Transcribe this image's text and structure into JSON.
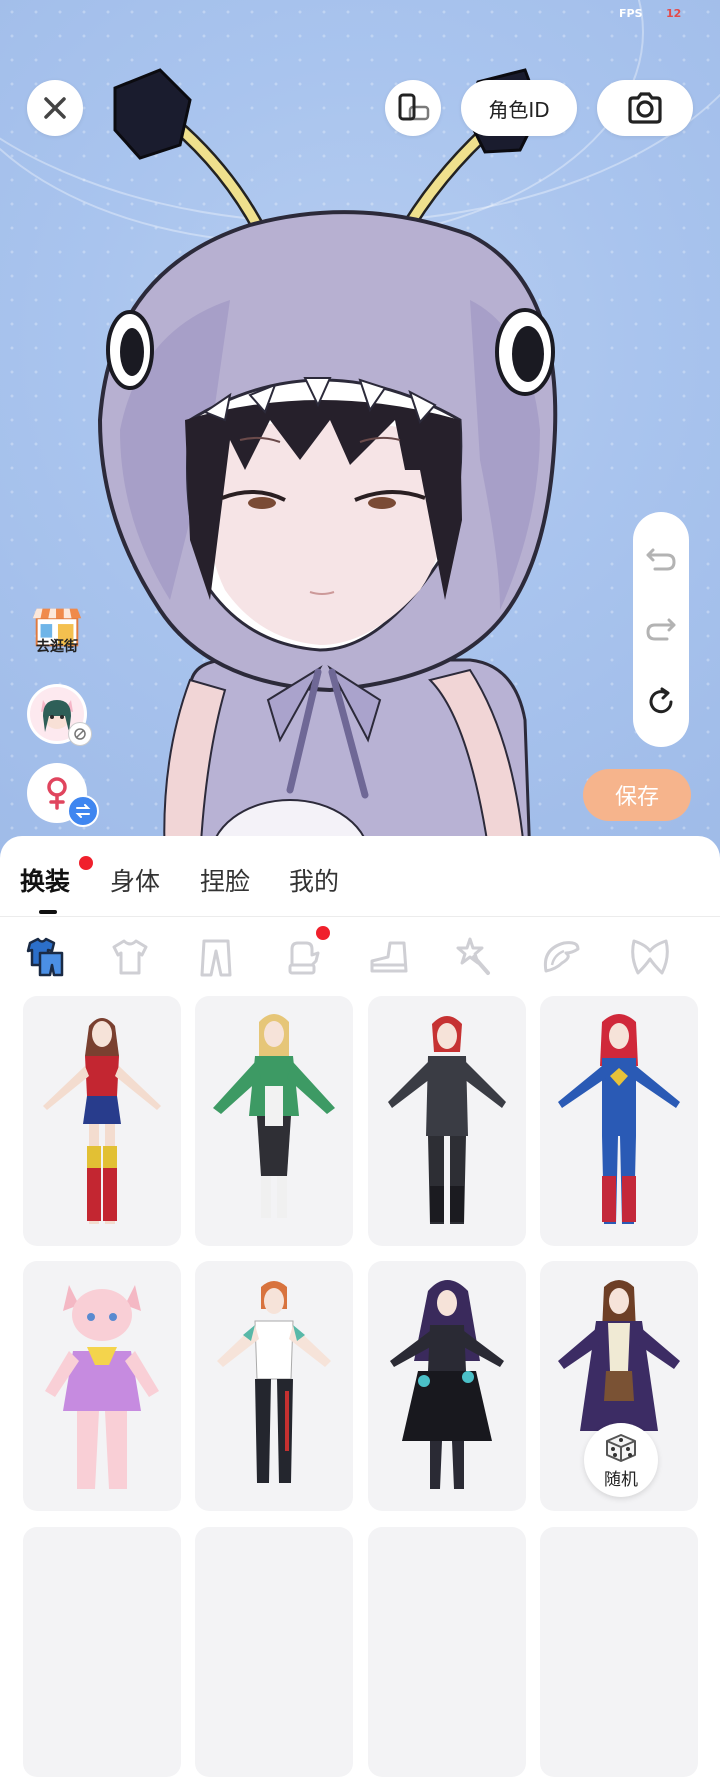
{
  "status": {
    "fps_label": "FPS",
    "fps_value": "12"
  },
  "top_bar": {
    "close_icon": "close-icon",
    "orientation_icon": "rotate-device-icon",
    "role_id_label": "角色ID",
    "camera_icon": "camera-icon"
  },
  "side": {
    "shop_label": "去逛街",
    "gender_icon": "female-icon"
  },
  "history": {
    "undo_icon": "undo-icon",
    "redo_icon": "redo-icon",
    "reset_icon": "reset-icon"
  },
  "save_label": "保存",
  "tabs": [
    {
      "label": "换装",
      "active": true,
      "badge": true
    },
    {
      "label": "身体",
      "active": false,
      "badge": false
    },
    {
      "label": "捏脸",
      "active": false,
      "badge": false
    },
    {
      "label": "我的",
      "active": false,
      "badge": false
    }
  ],
  "categories": [
    {
      "icon": "outfit-set-icon",
      "active": true
    },
    {
      "icon": "top-icon",
      "active": false
    },
    {
      "icon": "pants-icon",
      "active": false
    },
    {
      "icon": "glove-icon",
      "active": false,
      "badge": true
    },
    {
      "icon": "shoe-icon",
      "active": false
    },
    {
      "icon": "accessory-icon",
      "active": false
    },
    {
      "icon": "wing-icon",
      "active": false
    },
    {
      "icon": "bow-icon",
      "active": false
    }
  ],
  "random_label": "随机",
  "colors": {
    "accent_save": "#f6b48c",
    "badge_red": "#f0202c",
    "stage_bg": "#a9c4ee"
  }
}
